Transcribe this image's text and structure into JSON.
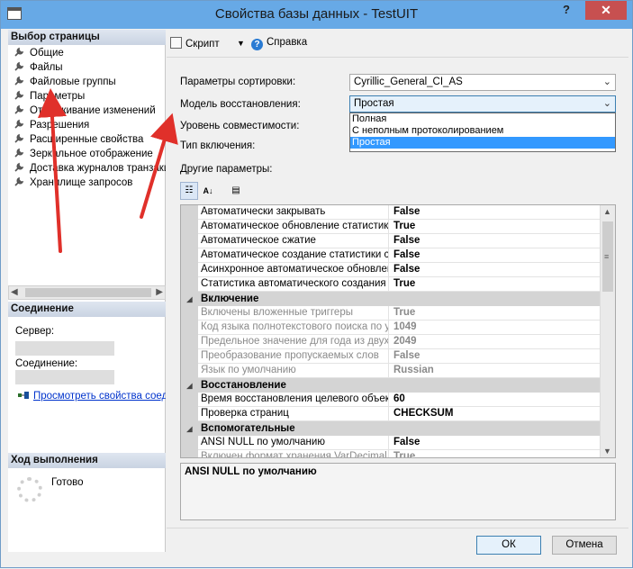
{
  "window": {
    "title": "Свойства базы данных - TestUIT",
    "close_label": "✕",
    "help_label": "?"
  },
  "left": {
    "select_page_header": "Выбор страницы",
    "pages": [
      {
        "label": "Общие"
      },
      {
        "label": "Файлы"
      },
      {
        "label": "Файловые группы"
      },
      {
        "label": "Параметры"
      },
      {
        "label": "Отслеживание изменений"
      },
      {
        "label": "Разрешения"
      },
      {
        "label": "Расширенные свойства"
      },
      {
        "label": "Зеркальное отображение"
      },
      {
        "label": "Доставка журналов транзакций"
      },
      {
        "label": "Хранилище запросов"
      }
    ],
    "connection_header": "Соединение",
    "server_label": "Сервер:",
    "connection_label": "Соединение:",
    "view_connection_link": "Просмотреть свойства соединения",
    "progress_header": "Ход выполнения",
    "progress_status": "Готово"
  },
  "toolbar": {
    "script_label": "Скрипт",
    "dropdown_arrow": "▼",
    "help_label": "Справка"
  },
  "form": {
    "collation_label": "Параметры сортировки:",
    "collation_value": "Cyrillic_General_CI_AS",
    "recovery_label": "Модель восстановления:",
    "recovery_value": "Простая",
    "compat_label": "Уровень совместимости:",
    "containment_label": "Тип включения:",
    "other_label": "Другие параметры:",
    "recovery_options": [
      "Полная",
      "С неполным протоколированием",
      "Простая"
    ],
    "selected_option_index": 2
  },
  "property_grid": {
    "rows_top": [
      {
        "name": "Автоматически закрывать",
        "value": "False"
      },
      {
        "name": "Автоматическое обновление статистики",
        "value": "True"
      },
      {
        "name": "Автоматическое сжатие",
        "value": "False"
      },
      {
        "name": "Автоматическое создание статистики с добавочным",
        "value": "False"
      },
      {
        "name": "Асинхронное автоматическое обновление статистики",
        "value": "False"
      },
      {
        "name": "Статистика автоматического создания",
        "value": "True"
      }
    ],
    "category_containment": "Включение",
    "rows_containment": [
      {
        "name": "Включены вложенные триггеры",
        "value": "True"
      },
      {
        "name": "Код языка полнотекстового поиска по умолчанию",
        "value": "1049"
      },
      {
        "name": "Предельное значение для года из двух цифр",
        "value": "2049"
      },
      {
        "name": "Преобразование пропускаемых слов",
        "value": "False"
      },
      {
        "name": "Язык по умолчанию",
        "value": "Russian"
      }
    ],
    "category_recovery": "Восстановление",
    "rows_recovery": [
      {
        "name": "Время восстановления целевого объекта (секунды)",
        "value": "60"
      },
      {
        "name": "Проверка страниц",
        "value": "CHECKSUM"
      }
    ],
    "category_misc": "Вспомогательные",
    "rows_misc": [
      {
        "name": "ANSI NULL по умолчанию",
        "value": "False"
      },
      {
        "name": "Включен формат хранения VarDecimal",
        "value": "True"
      }
    ]
  },
  "description": "ANSI NULL по умолчанию",
  "buttons": {
    "ok": "ОК",
    "cancel": "Отмена"
  },
  "colors": {
    "annotation_arrow": "#e0302a",
    "titlebar": "#67a9e6",
    "selection": "#3399ff"
  }
}
